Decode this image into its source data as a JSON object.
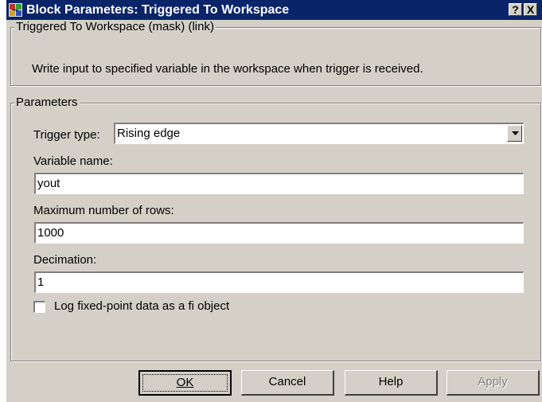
{
  "window": {
    "title": "Block Parameters: Triggered To Workspace",
    "help_button": "?",
    "close_button": "X"
  },
  "mask_group": {
    "legend": "Triggered To Workspace (mask) (link)",
    "description": "Write input to specified variable in the workspace when trigger is received."
  },
  "parameters": {
    "legend": "Parameters",
    "trigger_type_label": "Trigger type:",
    "trigger_type_value": "Rising edge",
    "variable_name_label": "Variable name:",
    "variable_name_value": "yout",
    "max_rows_label": "Maximum number of rows:",
    "max_rows_value": "1000",
    "decimation_label": "Decimation:",
    "decimation_value": "1",
    "log_fixed_point_label": "Log fixed-point data as a fi object",
    "log_fixed_point_checked": false
  },
  "buttons": {
    "ok": "OK",
    "cancel": "Cancel",
    "help": "Help",
    "apply": "Apply"
  },
  "icons": {
    "app": "simulink-block-icon",
    "help": "help-icon",
    "close": "close-icon",
    "dropdown": "chevron-down-icon"
  },
  "colors": {
    "titlebar": "#0a246a",
    "face": "#d4d0c8"
  }
}
